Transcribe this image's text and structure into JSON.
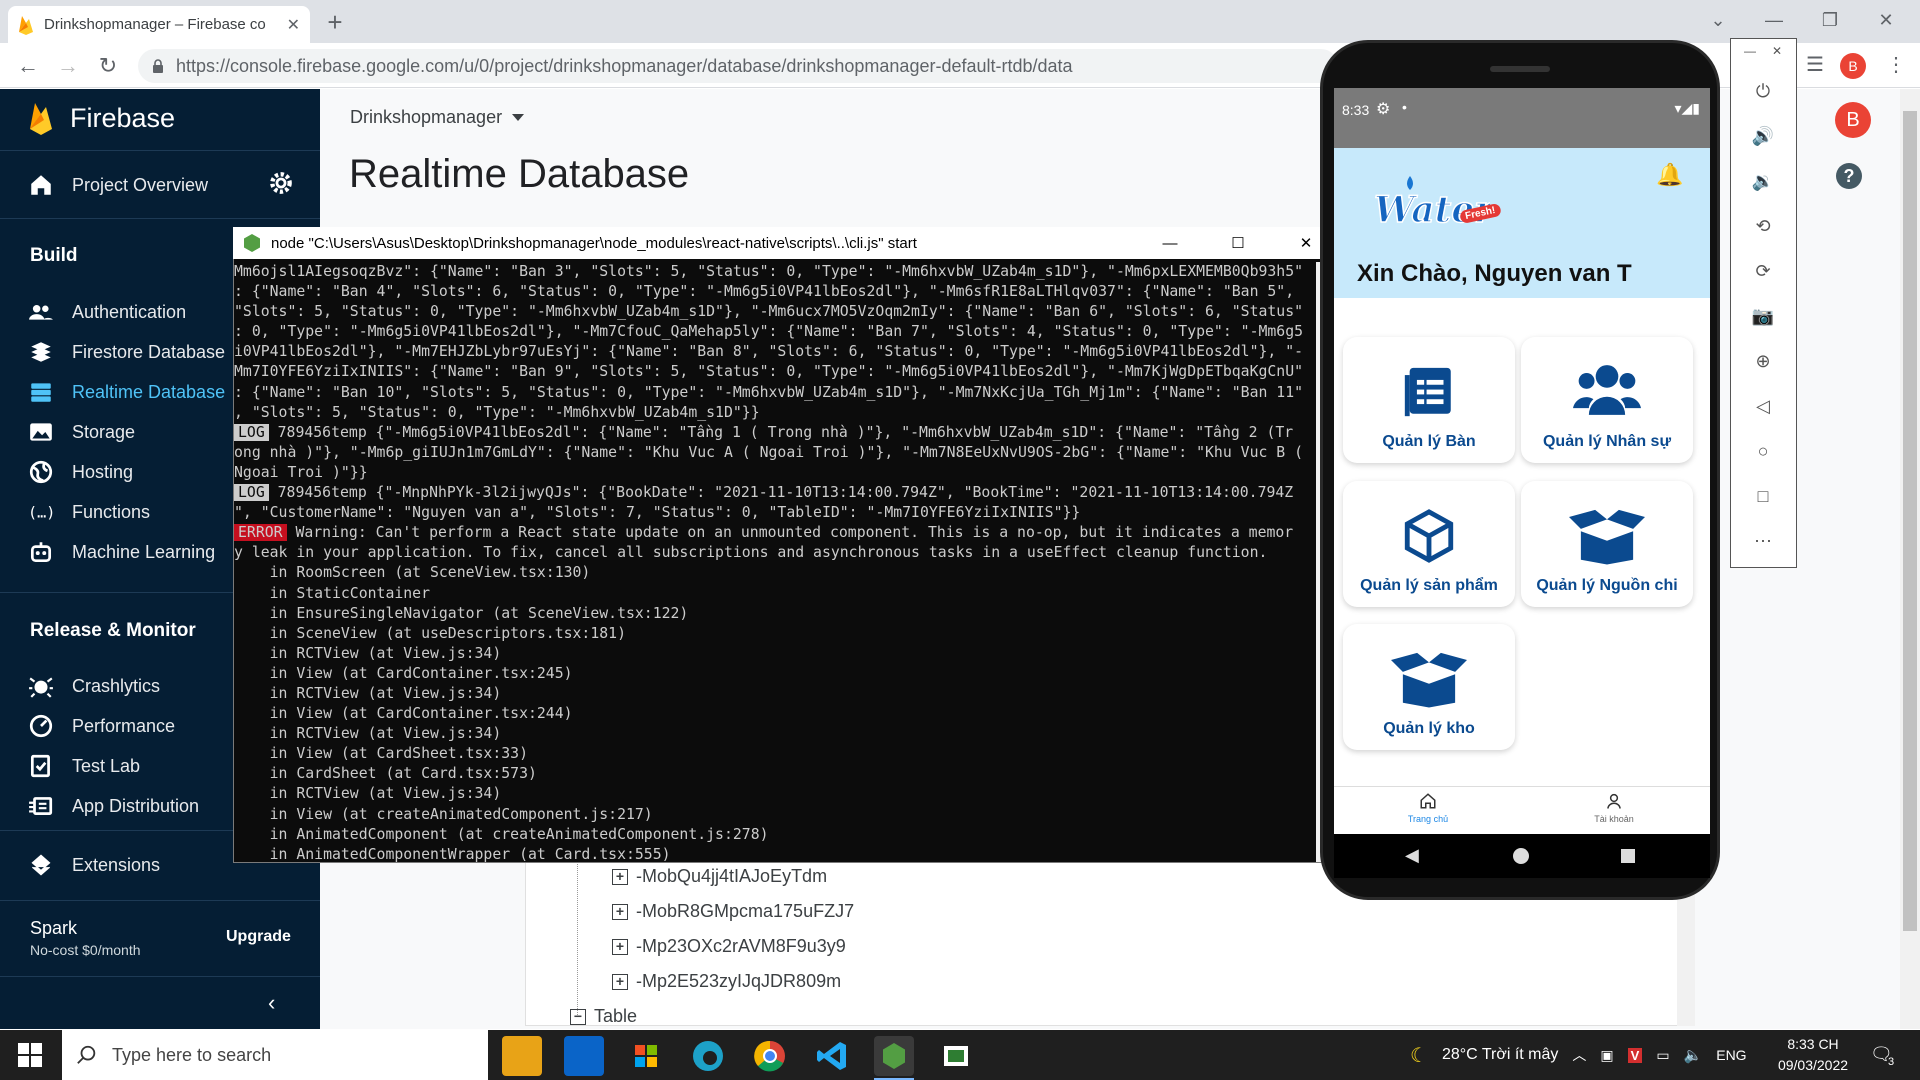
{
  "browser": {
    "tab_title": "Drinkshopmanager – Firebase co",
    "url": "https://console.firebase.google.com/u/0/project/drinkshopmanager/database/drinkshopmanager-default-rtdb/data",
    "profile_initial": "B"
  },
  "firebase": {
    "brand": "Firebase",
    "project_overview": "Project Overview",
    "build_heading": "Build",
    "build_items": [
      "Authentication",
      "Firestore Database",
      "Realtime Database",
      "Storage",
      "Hosting",
      "Functions",
      "Machine Learning"
    ],
    "release_heading": "Release & Monitor",
    "release_items": [
      "Crashlytics",
      "Performance",
      "Test Lab",
      "App Distribution"
    ],
    "extensions": "Extensions",
    "plan_name": "Spark",
    "plan_price": "No-cost $0/month",
    "upgrade": "Upgrade",
    "project_name": "Drinkshopmanager",
    "page_title": "Realtime Database",
    "tree_items": [
      "-MobQu4jj4tIAJoEyTdm",
      "-MobR8GMpcma175uFZJ7",
      "-Mp23OXc2rAVM8F9u3y9",
      "-Mp2E523zyIJqJDR809m"
    ],
    "tree_table": "Table"
  },
  "terminal": {
    "title": "node  \"C:\\Users\\Asus\\Desktop\\Drinkshopmanager\\node_modules\\react-native\\scripts\\..\\cli.js\" start",
    "lines": [
      {
        "badge": "",
        "text": "Mm6ojsl1AIegsoqzBvz\": {\"Name\": \"Ban 3\", \"Slots\": 5, \"Status\": 0, \"Type\": \"-Mm6hxvbW_UZab4m_s1D\"}, \"-Mm6pxLEXMEMB0Qb93h5\""
      },
      {
        "badge": "",
        "text": ": {\"Name\": \"Ban 4\", \"Slots\": 6, \"Status\": 0, \"Type\": \"-Mm6g5i0VP41lbEos2dl\"}, \"-Mm6sfR1E8aLTHlqv037\": {\"Name\": \"Ban 5\","
      },
      {
        "badge": "",
        "text": "\"Slots\": 5, \"Status\": 0, \"Type\": \"-Mm6hxvbW_UZab4m_s1D\"}, \"-Mm6ucx7MO5VzOqm2mIy\": {\"Name\": \"Ban 6\", \"Slots\": 6, \"Status\""
      },
      {
        "badge": "",
        "text": ": 0, \"Type\": \"-Mm6g5i0VP41lbEos2dl\"}, \"-Mm7CfouC_QaMehap5ly\": {\"Name\": \"Ban 7\", \"Slots\": 4, \"Status\": 0, \"Type\": \"-Mm6g5"
      },
      {
        "badge": "",
        "text": "i0VP41lbEos2dl\"}, \"-Mm7EHJZbLybr97uEsYj\": {\"Name\": \"Ban 8\", \"Slots\": 6, \"Status\": 0, \"Type\": \"-Mm6g5i0VP41lbEos2dl\"}, \"-"
      },
      {
        "badge": "",
        "text": "Mm7I0YFE6YziIxINIIS\": {\"Name\": \"Ban 9\", \"Slots\": 5, \"Status\": 0, \"Type\": \"-Mm6g5i0VP41lbEos2dl\"}, \"-Mm7KjWgDpETbqaKgCnU\""
      },
      {
        "badge": "",
        "text": ": {\"Name\": \"Ban 10\", \"Slots\": 5, \"Status\": 0, \"Type\": \"-Mm6hxvbW_UZab4m_s1D\"}, \"-Mm7NxKcjUa_TGh_Mj1m\": {\"Name\": \"Ban 11\""
      },
      {
        "badge": "",
        "text": ", \"Slots\": 5, \"Status\": 0, \"Type\": \"-Mm6hxvbW_UZab4m_s1D\"}}"
      },
      {
        "badge": "LOG",
        "text": " 789456temp {\"-Mm6g5i0VP41lbEos2dl\": {\"Name\": \"Tầng 1 ( Trong nhà )\"}, \"-Mm6hxvbW_UZab4m_s1D\": {\"Name\": \"Tầng 2 (Tr"
      },
      {
        "badge": "",
        "text": "ong nhà )\"}, \"-Mm6p_giIUJn1m7GmLdY\": {\"Name\": \"Khu Vuc A ( Ngoai Troi )\"}, \"-Mm7N8EeUxNvU9OS-2bG\": {\"Name\": \"Khu Vuc B ("
      },
      {
        "badge": "",
        "text": "Ngoai Troi )\"}}"
      },
      {
        "badge": "LOG",
        "text": " 789456temp {\"-MnpNhPYk-3l2ijwyQJs\": {\"BookDate\": \"2021-11-10T13:14:00.794Z\", \"BookTime\": \"2021-11-10T13:14:00.794Z"
      },
      {
        "badge": "",
        "text": "\", \"CustomerName\": \"Nguyen van a\", \"Slots\": 7, \"Status\": 0, \"TableID\": \"-Mm7I0YFE6YziIxINIIS\"}}"
      },
      {
        "badge": "ERROR",
        "text": " Warning: Can't perform a React state update on an unmounted component. This is a no-op, but it indicates a memor"
      },
      {
        "badge": "",
        "text": "y leak in your application. To fix, cancel all subscriptions and asynchronous tasks in a useEffect cleanup function."
      },
      {
        "badge": "",
        "text": "    in RoomScreen (at SceneView.tsx:130)"
      },
      {
        "badge": "",
        "text": "    in StaticContainer"
      },
      {
        "badge": "",
        "text": "    in EnsureSingleNavigator (at SceneView.tsx:122)"
      },
      {
        "badge": "",
        "text": "    in SceneView (at useDescriptors.tsx:181)"
      },
      {
        "badge": "",
        "text": "    in RCTView (at View.js:34)"
      },
      {
        "badge": "",
        "text": "    in View (at CardContainer.tsx:245)"
      },
      {
        "badge": "",
        "text": "    in RCTView (at View.js:34)"
      },
      {
        "badge": "",
        "text": "    in View (at CardContainer.tsx:244)"
      },
      {
        "badge": "",
        "text": "    in RCTView (at View.js:34)"
      },
      {
        "badge": "",
        "text": "    in View (at CardSheet.tsx:33)"
      },
      {
        "badge": "",
        "text": "    in CardSheet (at Card.tsx:573)"
      },
      {
        "badge": "",
        "text": "    in RCTView (at View.js:34)"
      },
      {
        "badge": "",
        "text": "    in View (at createAnimatedComponent.js:217)"
      },
      {
        "badge": "",
        "text": "    in AnimatedComponent (at createAnimatedComponent.js:278)"
      },
      {
        "badge": "",
        "text": "    in AnimatedComponentWrapper (at Card.tsx:555)"
      }
    ]
  },
  "phone": {
    "time": "8:33",
    "logo_text": "Water",
    "logo_sub": "Fresh!",
    "greeting": "Xin Chào, Nguyen van T",
    "cards": [
      "Quản lý Bàn",
      "Quản lý Nhân sự",
      "Quản lý sản phẩm",
      "Quản lý Nguồn chi",
      "Quản lý kho"
    ],
    "nav_home": "Trang chủ",
    "nav_account": "Tài khoản"
  },
  "taskbar": {
    "search_placeholder": "Type here to search",
    "weather": "28°C  Trời ít mây",
    "lang": "ENG",
    "time": "8:33 CH",
    "date": "09/03/2022",
    "notifications": "3"
  },
  "colors": {
    "firebase_sidebar": "#051e34",
    "active_blue": "#4fc3f7",
    "card_blue": "#0b4a8f",
    "error_red": "#c50f1f"
  }
}
